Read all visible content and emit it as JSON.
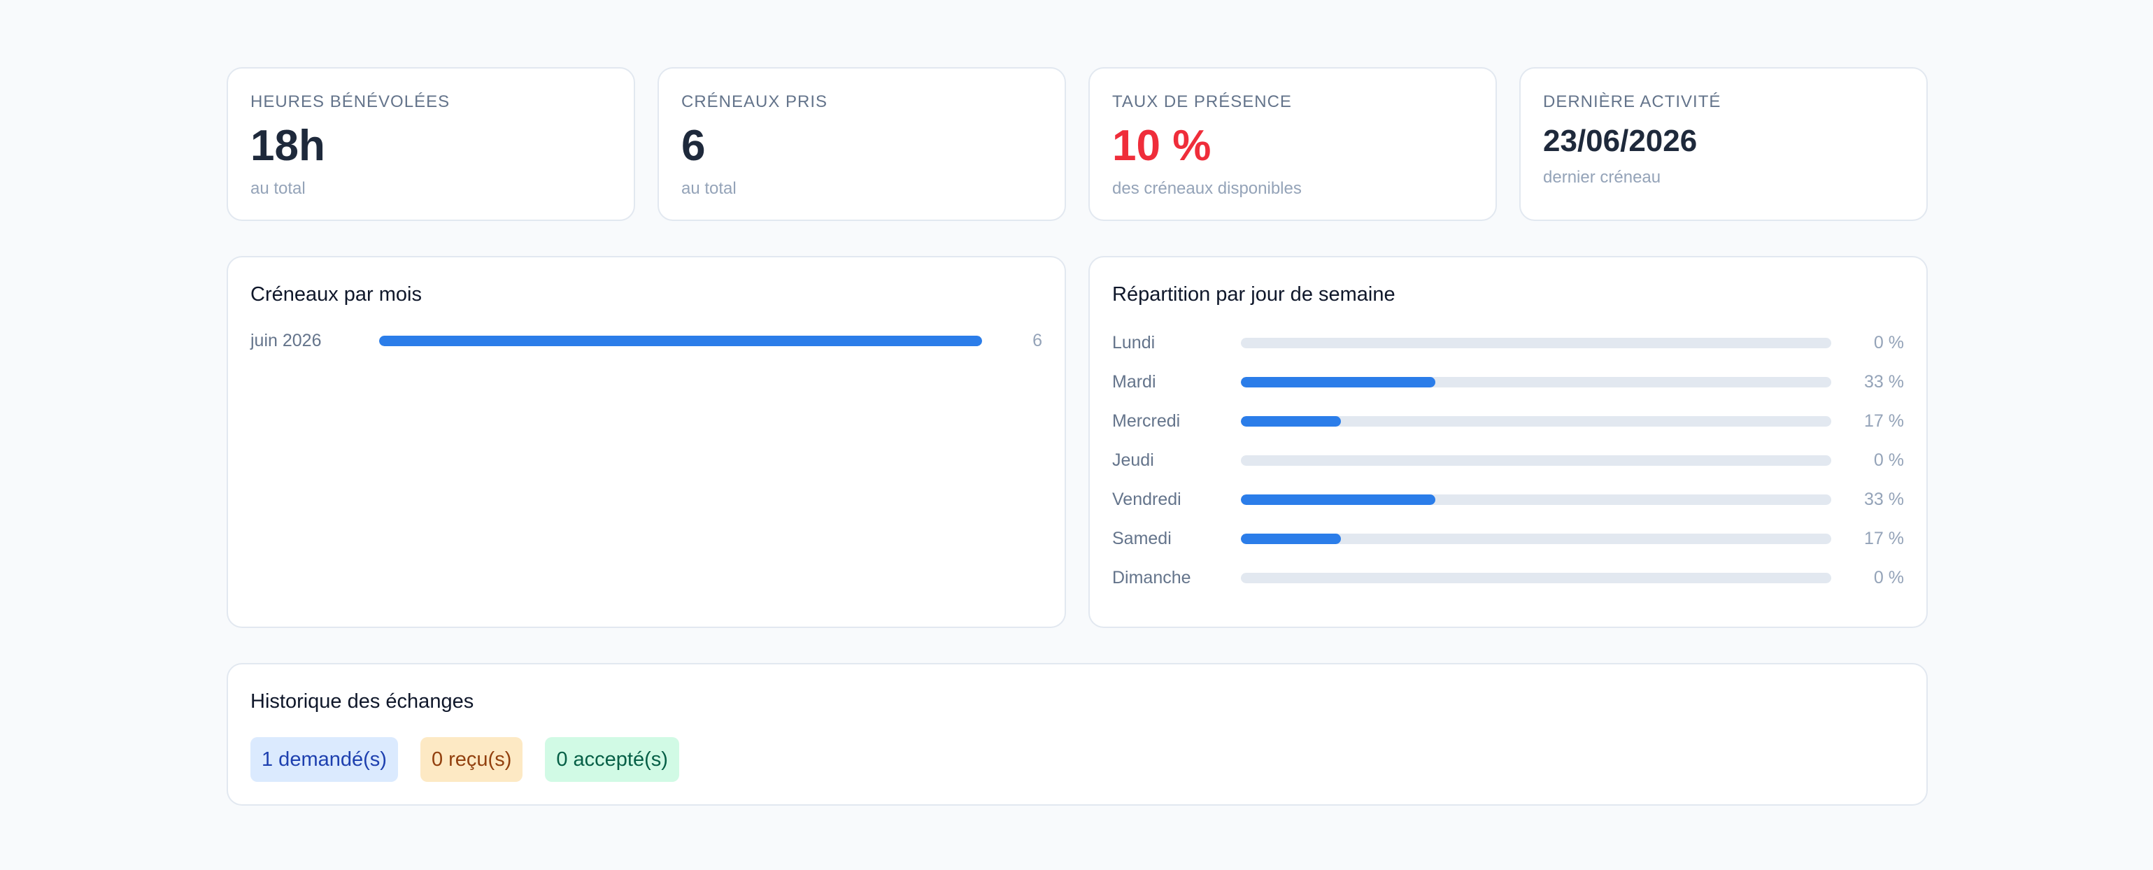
{
  "stats": [
    {
      "label": "HEURES BÉNÉVOLÉES",
      "value": "18h",
      "sub": "au total"
    },
    {
      "label": "CRÉNEAUX PRIS",
      "value": "6",
      "sub": "au total"
    },
    {
      "label": "TAUX DE PRÉSENCE",
      "value": "10 %",
      "sub": "des créneaux disponibles"
    },
    {
      "label": "DERNIÈRE ACTIVITÉ",
      "value": "23/06/2026",
      "sub": "dernier créneau"
    }
  ],
  "colors": {
    "accent": "#2b7de9",
    "alert": "#ef2d3a",
    "track": "#e2e8f0"
  },
  "monthly": {
    "title": "Créneaux par mois",
    "rows": [
      {
        "label": "juin 2026",
        "value": "6",
        "fraction": 1.0
      }
    ]
  },
  "weekday": {
    "title": "Répartition par jour de semaine",
    "rows": [
      {
        "label": "Lundi",
        "value": "0 %",
        "fraction": 0
      },
      {
        "label": "Mardi",
        "value": "33 %",
        "fraction": 0.33
      },
      {
        "label": "Mercredi",
        "value": "17 %",
        "fraction": 0.17
      },
      {
        "label": "Jeudi",
        "value": "0 %",
        "fraction": 0
      },
      {
        "label": "Vendredi",
        "value": "33 %",
        "fraction": 0.33
      },
      {
        "label": "Samedi",
        "value": "17 %",
        "fraction": 0.17
      },
      {
        "label": "Dimanche",
        "value": "0 %",
        "fraction": 0
      }
    ]
  },
  "history": {
    "title": "Historique des échanges",
    "requested": "1 demandé(s)",
    "received": "0 reçu(s)",
    "accepted": "0 accepté(s)"
  }
}
